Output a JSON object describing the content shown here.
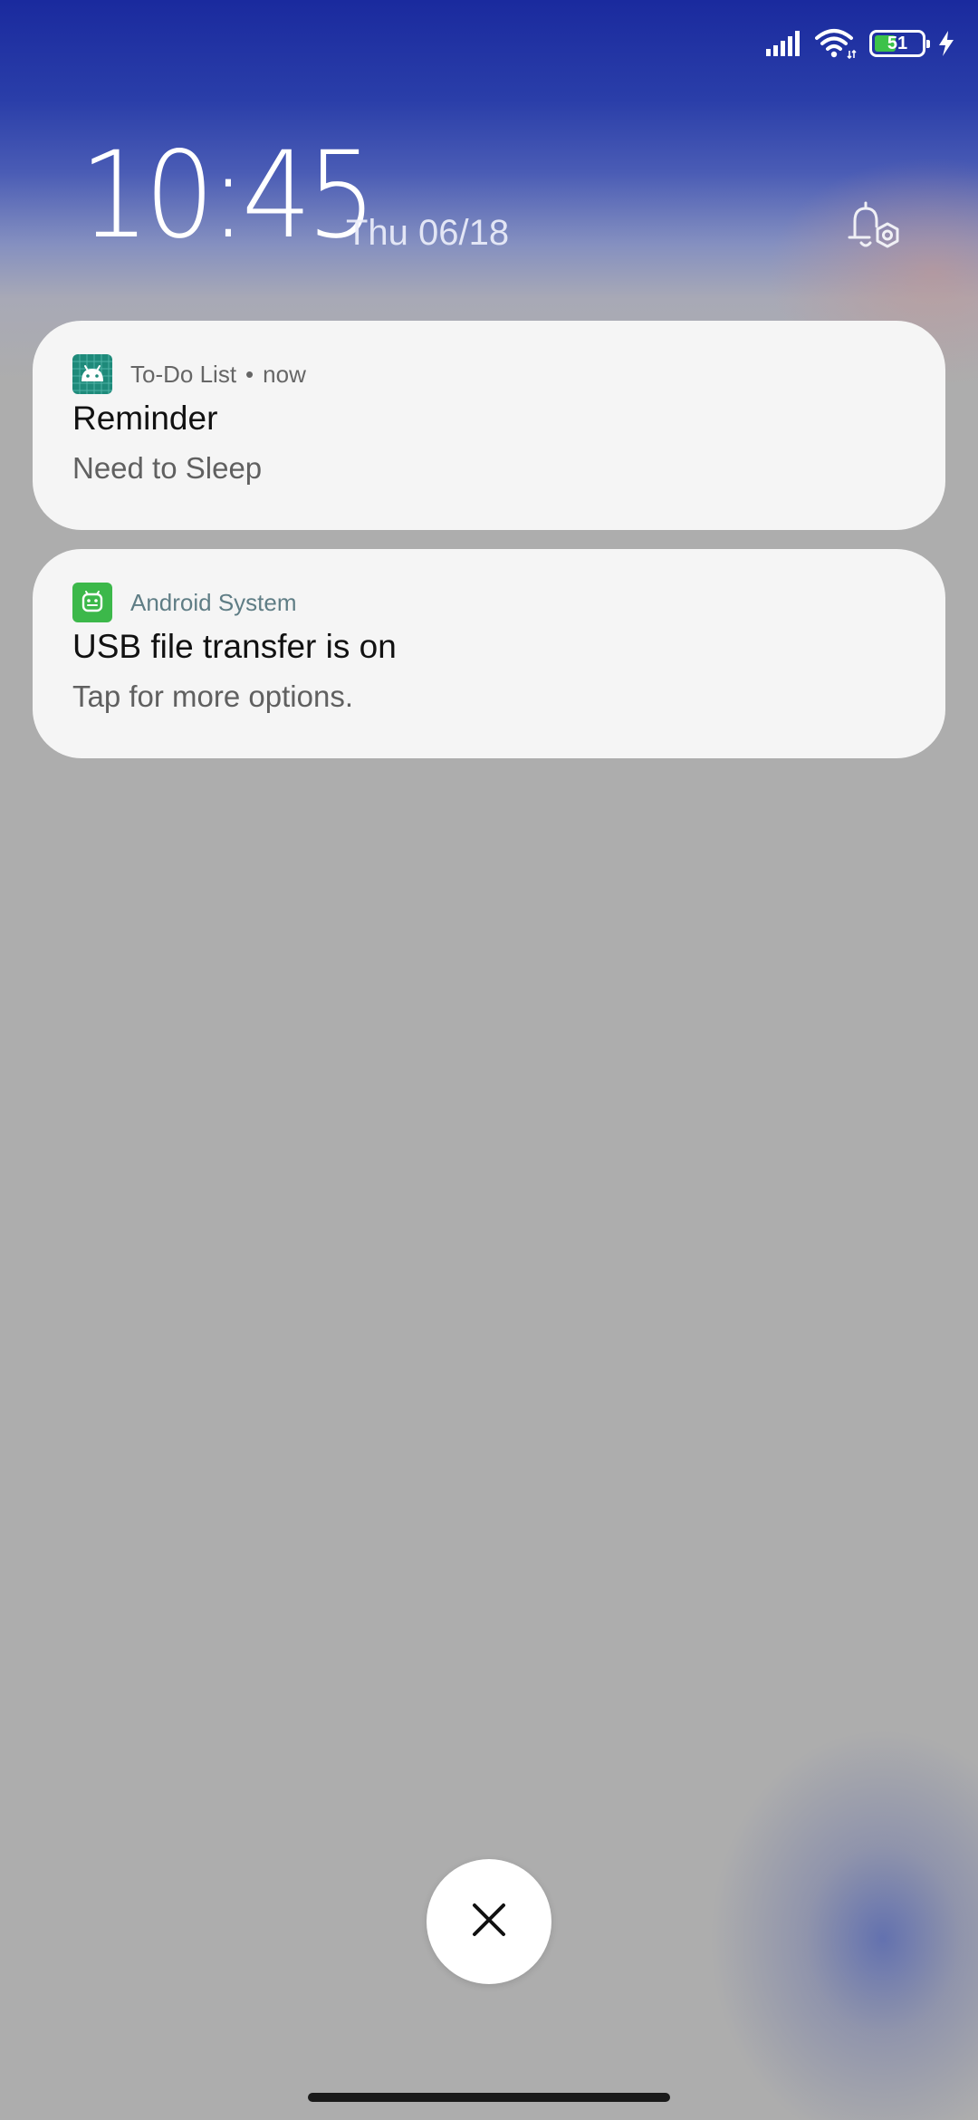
{
  "status_bar": {
    "signal_icon": "cellular-signal-icon",
    "wifi_icon": "wifi-icon",
    "battery_level": "51",
    "battery_percent": 51,
    "charging_icon": "charging-bolt-icon",
    "battery_color": "#3cc24a"
  },
  "lock_screen": {
    "time": "10:45",
    "date": "Thu 06/18",
    "notification_settings_icon": "bell-settings-icon"
  },
  "notifications": [
    {
      "app_icon": "android-robot-icon",
      "app_icon_color": "#1e8a7a",
      "app_name": "To-Do List",
      "separator": "•",
      "time": "now",
      "title": "Reminder",
      "body": "Need to Sleep"
    },
    {
      "app_icon": "android-system-icon",
      "app_icon_color": "#3cb84a",
      "app_name": "Android System",
      "title": "USB file transfer is on",
      "body": "Tap for more options."
    }
  ],
  "dismiss_button": {
    "icon": "close-icon"
  }
}
